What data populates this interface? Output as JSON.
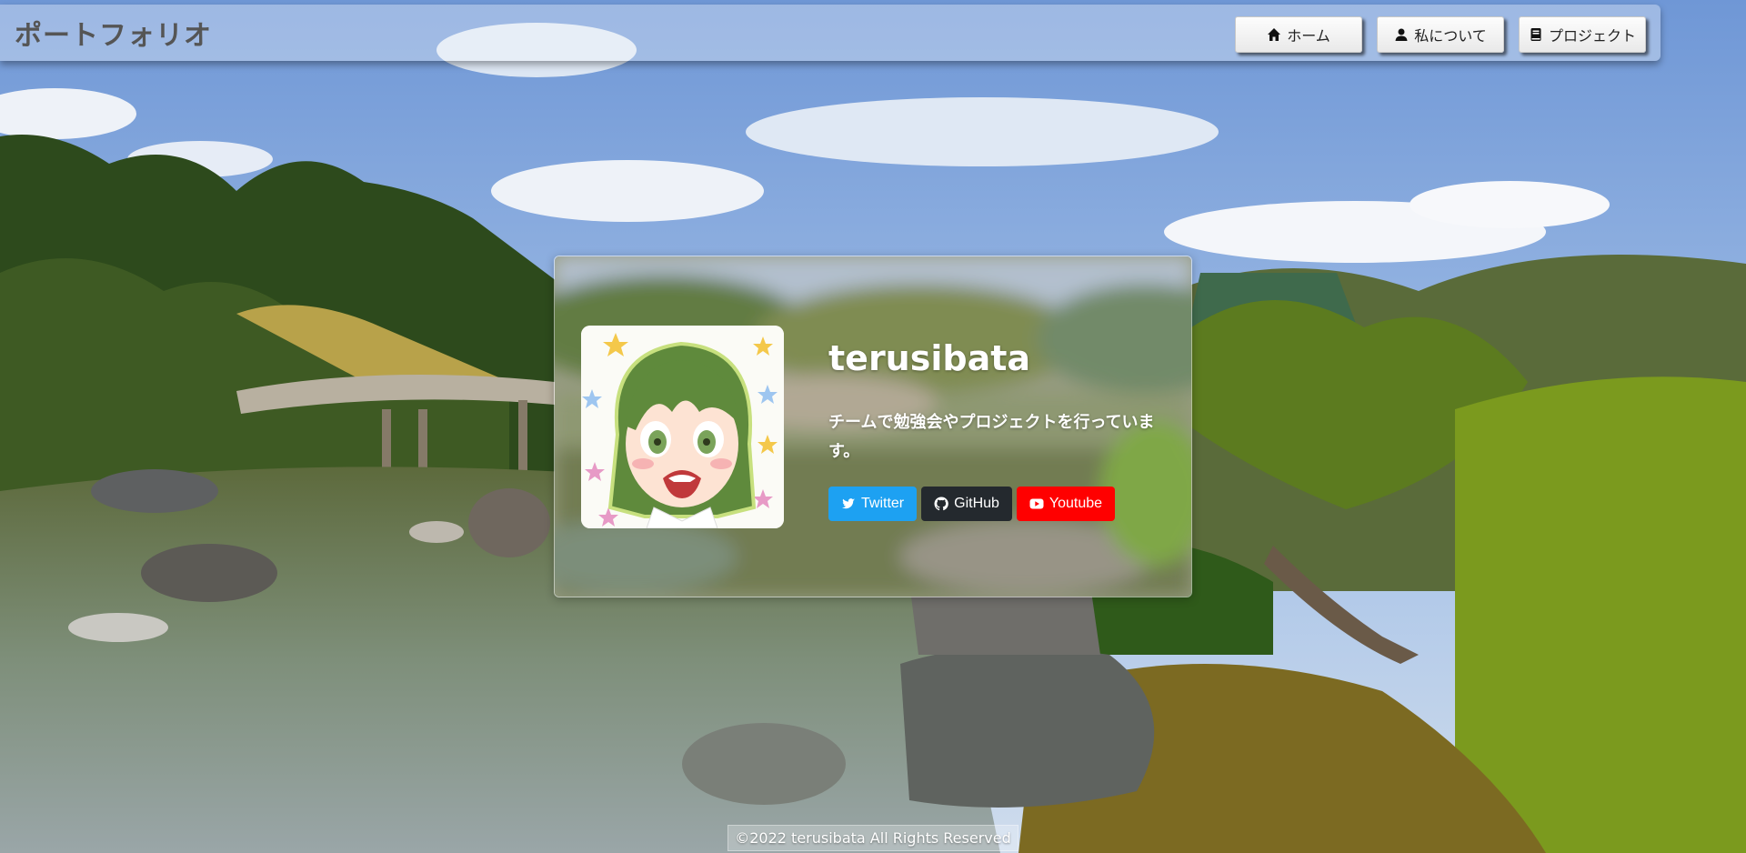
{
  "header": {
    "brand": "ポートフォリオ",
    "nav": [
      {
        "label": "ホーム",
        "icon": "home-icon"
      },
      {
        "label": "私について",
        "icon": "user-icon"
      },
      {
        "label": "プロジェクト",
        "icon": "book-icon"
      }
    ]
  },
  "profile": {
    "name": "terusibata",
    "bio": "チームで勉強会やプロジェクトを行っています。",
    "avatar_icon": "anime-avatar-icon",
    "links": [
      {
        "label": "Twitter",
        "icon": "twitter-icon",
        "color": "#1da1f2"
      },
      {
        "label": "GitHub",
        "icon": "github-icon",
        "color": "#24292e"
      },
      {
        "label": "Youtube",
        "icon": "youtube-icon",
        "color": "#ff0000"
      }
    ]
  },
  "footer": {
    "copyright": "©2022 terusibata All Rights Reserved"
  }
}
